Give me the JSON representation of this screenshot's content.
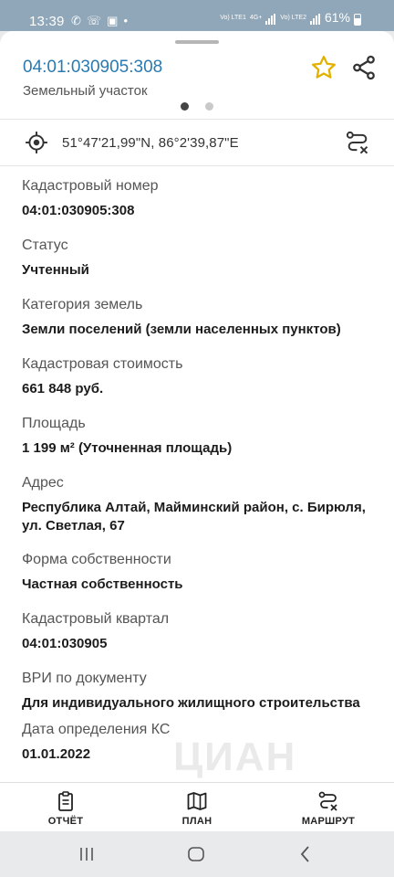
{
  "status_bar": {
    "time": "13:39",
    "battery": "61%",
    "sim1": "Vo) LTE1",
    "sim2": "Vo) LTE2",
    "net": "4G+"
  },
  "header": {
    "title": "04:01:030905:308",
    "subtitle": "Земельный участок",
    "accent_color": "#2a7ab0",
    "star_color": "#e2b100"
  },
  "pager": {
    "count": 2,
    "active": 1
  },
  "coordinates": {
    "text": "51°47'21,99\"N, 86°2'39,87\"E"
  },
  "fields": [
    {
      "label": "Кадастровый номер",
      "value": "04:01:030905:308"
    },
    {
      "label": "Статус",
      "value": "Учтенный"
    },
    {
      "label": "Категория земель",
      "value": "Земли поселений (земли населенных пунктов)"
    },
    {
      "label": "Кадастровая стоимость",
      "value": "661 848 руб."
    },
    {
      "label": "Площадь",
      "value": "1 199 м² (Уточненная площадь)"
    },
    {
      "label": "Адрес",
      "value": "Республика Алтай, Майминский район, с. Бирюля, ул. Светлая, 67"
    },
    {
      "label": "Форма собственности",
      "value": "Частная собственность"
    },
    {
      "label": "Кадастровый квартал",
      "value": "04:01:030905"
    },
    {
      "label": "ВРИ по документу",
      "value": "Для индивидуального жилищного строительства"
    },
    {
      "label": "Дата определения КС",
      "value": "01.01.2022"
    }
  ],
  "bottom_nav": {
    "report": "ОТЧЁТ",
    "plan": "ПЛАН",
    "route": "МАРШРУТ"
  }
}
